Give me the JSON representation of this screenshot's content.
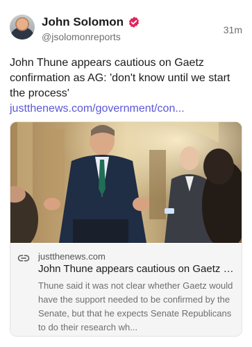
{
  "author": {
    "name": "John Solomon",
    "handle": "@jsolomonreports"
  },
  "post": {
    "time": "31m",
    "text": "John Thune appears cautious on Gaetz confirmation as AG: 'don't know until we start the process' ",
    "link_text": "justthenews.com/government/con..."
  },
  "link_card": {
    "domain": "justthenews.com",
    "title": "John Thune appears cautious on Gaetz confirmation as AG: 'don't know until we start the process'",
    "description": "Thune said it was not clear whether Gaetz would have the support needed to be confirmed by the Senate, but that he expects Senate Republicans to do their research wh..."
  },
  "colors": {
    "link": "#5b57d6",
    "verified_badge": "#e0245e"
  },
  "icons": {
    "verified": "verified-badge-icon",
    "link": "link-icon"
  }
}
